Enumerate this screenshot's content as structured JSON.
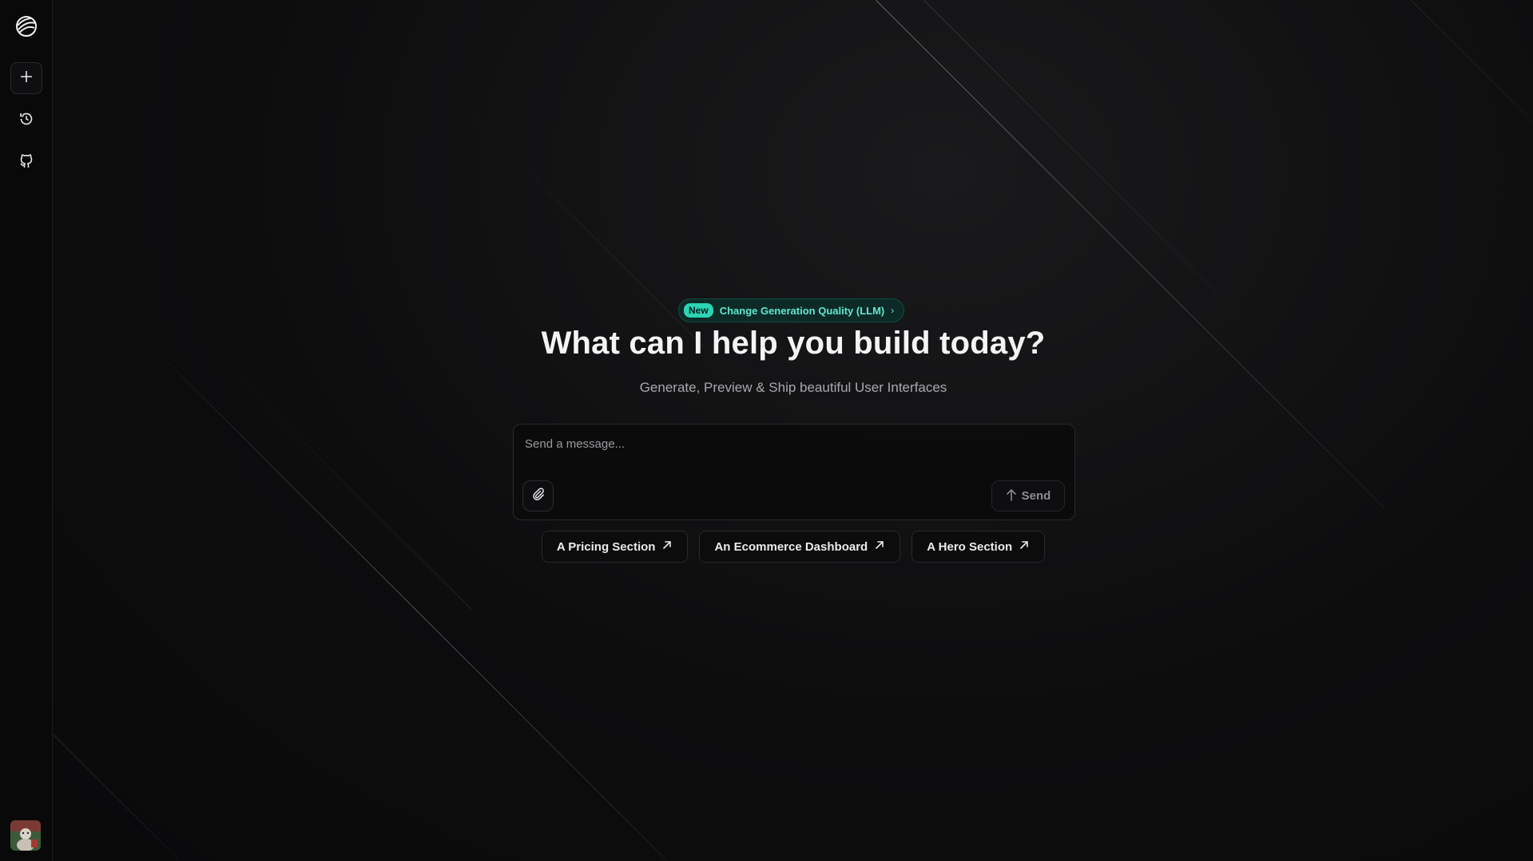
{
  "sidebar": {
    "logo_icon": "globe-logo-icon",
    "items": [
      {
        "name": "new-chat",
        "icon": "plus-icon"
      },
      {
        "name": "history",
        "icon": "history-icon"
      },
      {
        "name": "github",
        "icon": "github-icon"
      }
    ],
    "avatar_icon": "user-avatar"
  },
  "announcement": {
    "tag": "New",
    "text": "Change Generation Quality (LLM)",
    "chevron": "›"
  },
  "hero": {
    "title": "What can I help you build today?",
    "subtitle": "Generate, Preview & Ship beautiful User Interfaces"
  },
  "composer": {
    "placeholder": "Send a message...",
    "value": "",
    "attach_icon": "paperclip-icon",
    "send_label": "Send",
    "send_icon": "arrow-up-icon"
  },
  "suggestions": [
    {
      "label": "A Pricing Section",
      "icon": "arrow-up-right-icon"
    },
    {
      "label": "An Ecommerce Dashboard",
      "icon": "arrow-up-right-icon"
    },
    {
      "label": "A Hero Section",
      "icon": "arrow-up-right-icon"
    }
  ],
  "colors": {
    "background": "#0b0b0c",
    "accent": "#2bd4b5",
    "text": "#f4f4f5",
    "muted": "#a9a9ae"
  }
}
